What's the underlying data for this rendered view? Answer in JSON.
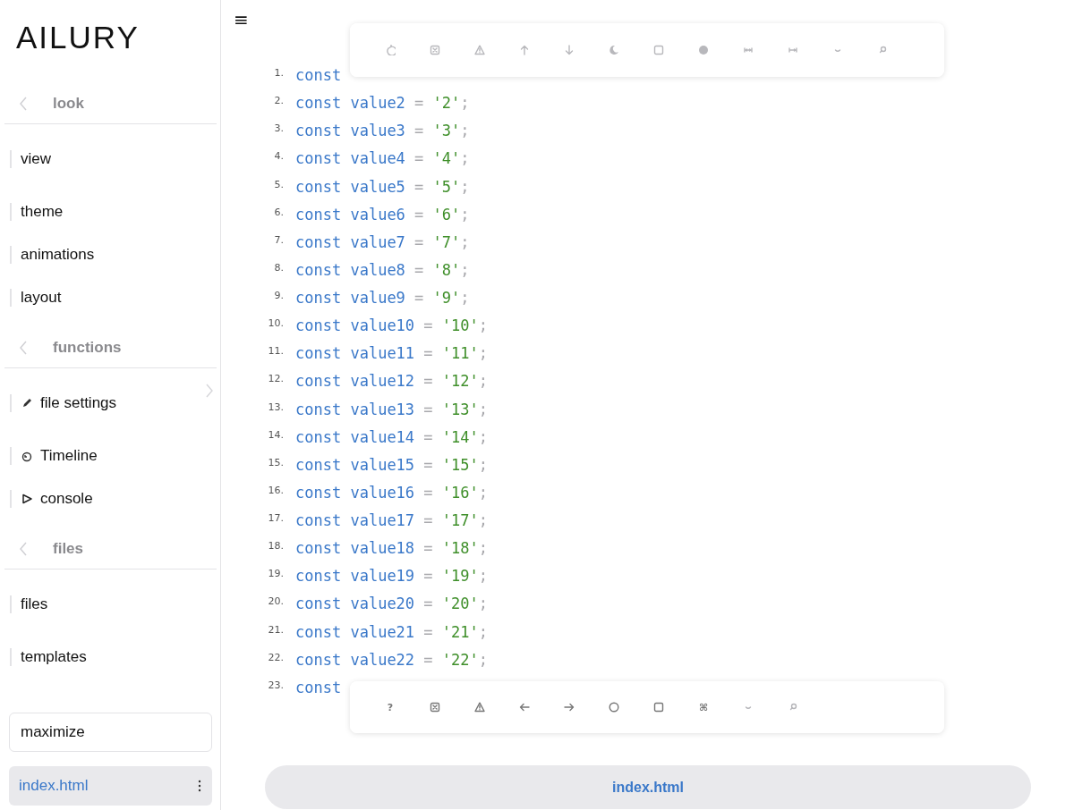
{
  "sidebar": {
    "title": "AILURY",
    "sections": [
      {
        "heading": "look",
        "items": [
          {
            "label": "view"
          },
          {
            "label": "theme"
          },
          {
            "label": "animations"
          },
          {
            "label": "layout"
          }
        ]
      },
      {
        "heading": "functions",
        "items": [
          {
            "label": "file settings",
            "kind": "pencil",
            "has_submenu": true
          },
          {
            "label": "Timeline",
            "kind": "clock"
          },
          {
            "label": "console",
            "kind": "play"
          }
        ]
      },
      {
        "heading": "files",
        "items": [
          {
            "label": "files"
          },
          {
            "label": "templates"
          }
        ]
      }
    ],
    "maximize_button": "maximize",
    "current_file": {
      "label": "index.html",
      "selected": true
    }
  },
  "menu_button": "≡",
  "top_toolbar": [
    {
      "kind": "undo"
    },
    {
      "kind": "xbox"
    },
    {
      "kind": "warning"
    },
    {
      "kind": "up"
    },
    {
      "kind": "down"
    },
    {
      "kind": "moon"
    },
    {
      "kind": "square"
    },
    {
      "kind": "dot"
    },
    {
      "kind": "collapse"
    },
    {
      "kind": "expand"
    },
    {
      "kind": "smile"
    },
    {
      "kind": "search"
    }
  ],
  "code_lines": [
    {
      "number": "1.",
      "keyword": "const"
    },
    {
      "number": "2.",
      "keyword": "const",
      "name": "value2",
      "operator": "=",
      "value": "'2'",
      "end": ";"
    },
    {
      "number": "3.",
      "keyword": "const",
      "name": "value3",
      "operator": "=",
      "value": "'3'",
      "end": ";"
    },
    {
      "number": "4.",
      "keyword": "const",
      "name": "value4",
      "operator": "=",
      "value": "'4'",
      "end": ";"
    },
    {
      "number": "5.",
      "keyword": "const",
      "name": "value5",
      "operator": "=",
      "value": "'5'",
      "end": ";"
    },
    {
      "number": "6.",
      "keyword": "const",
      "name": "value6",
      "operator": "=",
      "value": "'6'",
      "end": ";"
    },
    {
      "number": "7.",
      "keyword": "const",
      "name": "value7",
      "operator": "=",
      "value": "'7'",
      "end": ";"
    },
    {
      "number": "8.",
      "keyword": "const",
      "name": "value8",
      "operator": "=",
      "value": "'8'",
      "end": ";"
    },
    {
      "number": "9.",
      "keyword": "const",
      "name": "value9",
      "operator": "=",
      "value": "'9'",
      "end": ";"
    },
    {
      "number": "10.",
      "keyword": "const",
      "name": "value10",
      "operator": "=",
      "value": "'10'",
      "end": ";"
    },
    {
      "number": "11.",
      "keyword": "const",
      "name": "value11",
      "operator": "=",
      "value": "'11'",
      "end": ";"
    },
    {
      "number": "12.",
      "keyword": "const",
      "name": "value12",
      "operator": "=",
      "value": "'12'",
      "end": ";"
    },
    {
      "number": "13.",
      "keyword": "const",
      "name": "value13",
      "operator": "=",
      "value": "'13'",
      "end": ";"
    },
    {
      "number": "14.",
      "keyword": "const",
      "name": "value14",
      "operator": "=",
      "value": "'14'",
      "end": ";"
    },
    {
      "number": "15.",
      "keyword": "const",
      "name": "value15",
      "operator": "=",
      "value": "'15'",
      "end": ";"
    },
    {
      "number": "16.",
      "keyword": "const",
      "name": "value16",
      "operator": "=",
      "value": "'16'",
      "end": ";"
    },
    {
      "number": "17.",
      "keyword": "const",
      "name": "value17",
      "operator": "=",
      "value": "'17'",
      "end": ";"
    },
    {
      "number": "18.",
      "keyword": "const",
      "name": "value18",
      "operator": "=",
      "value": "'18'",
      "end": ";"
    },
    {
      "number": "19.",
      "keyword": "const",
      "name": "value19",
      "operator": "=",
      "value": "'19'",
      "end": ";"
    },
    {
      "number": "20.",
      "keyword": "const",
      "name": "value20",
      "operator": "=",
      "value": "'20'",
      "end": ";"
    },
    {
      "number": "21.",
      "keyword": "const",
      "name": "value21",
      "operator": "=",
      "value": "'21'",
      "end": ";"
    },
    {
      "number": "22.",
      "keyword": "const",
      "name": "value22",
      "operator": "=",
      "value": "'22'",
      "end": ";"
    },
    {
      "number": "23.",
      "keyword": "const"
    }
  ],
  "bottom_toolbar": [
    {
      "kind": "text",
      "label": "?"
    },
    {
      "kind": "xbox"
    },
    {
      "kind": "warning"
    },
    {
      "kind": "left"
    },
    {
      "kind": "right"
    },
    {
      "kind": "circle"
    },
    {
      "kind": "square"
    },
    {
      "kind": "text",
      "label": "⌘"
    },
    {
      "kind": "smile"
    },
    {
      "kind": "search"
    }
  ],
  "file_tab": "index.html"
}
